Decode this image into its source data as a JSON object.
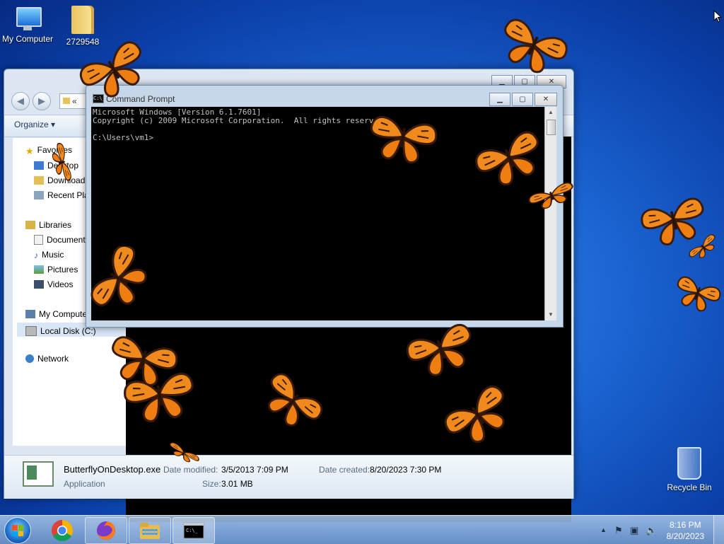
{
  "desktop": {
    "icons": [
      {
        "label": "My Computer",
        "icon": "computer-icon"
      },
      {
        "label": "2729548",
        "icon": "folder-icon"
      },
      {
        "label": "Recycle Bin",
        "icon": "recycle-bin-icon"
      }
    ]
  },
  "explorer": {
    "address": "«",
    "toolbar": {
      "organize_label": "Organize"
    },
    "nav": {
      "favorites": "Favorites",
      "desktop": "Desktop",
      "downloads": "Downloads",
      "recent_places": "Recent Places",
      "libraries": "Libraries",
      "documents": "Documents",
      "music": "Music",
      "pictures": "Pictures",
      "videos": "Videos",
      "my_computer": "My Computer",
      "local_disk": "Local Disk (C:)",
      "network": "Network"
    },
    "details": {
      "file_name": "ButterflyOnDesktop.exe",
      "file_type": "Application",
      "date_modified_label": "Date modified:",
      "date_modified": "3/5/2013 7:09 PM",
      "size_label": "Size:",
      "size": "3.01 MB",
      "date_created_label": "Date created:",
      "date_created": "8/20/2023 7:30 PM"
    }
  },
  "cmd": {
    "title": "Command Prompt",
    "icon_text": "C:\\_",
    "lines": [
      "Microsoft Windows [Version 6.1.7601]",
      "Copyright (c) 2009 Microsoft Corporation.  All rights reserved.",
      "",
      "C:\\Users\\vm1>"
    ]
  },
  "taskbar": {
    "apps": [
      {
        "name": "Google Chrome",
        "icon": "chrome-icon"
      },
      {
        "name": "Firefox",
        "icon": "firefox-icon"
      },
      {
        "name": "Windows Explorer",
        "icon": "explorer-icon"
      },
      {
        "name": "Command Prompt",
        "icon": "cmd-icon"
      }
    ],
    "clock": {
      "time": "8:16 PM",
      "date": "8/20/2023"
    }
  },
  "colors": {
    "butterfly_orange": "#f08a1c",
    "butterfly_dark": "#3a1a08",
    "desktop_blue": "#1b64d2"
  }
}
